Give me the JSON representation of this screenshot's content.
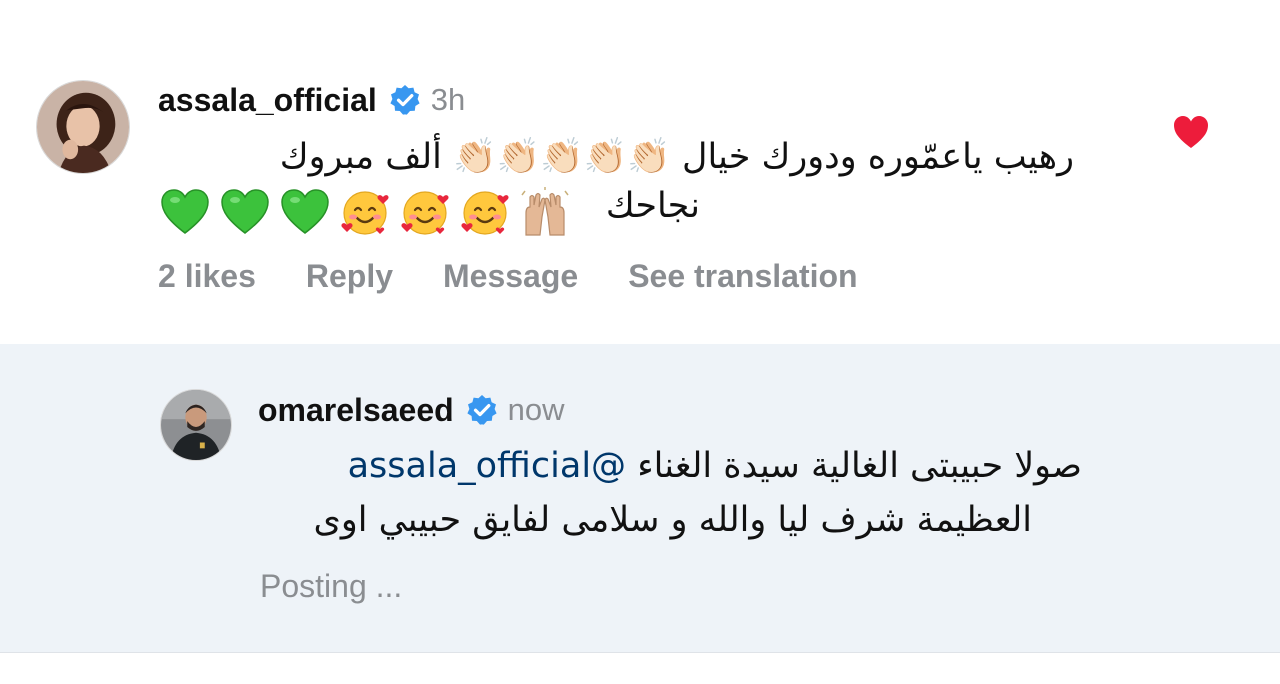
{
  "comment": {
    "username": "assala_official",
    "time": "3h",
    "text_line1": "رهيب ياعمّوره ودورك خيال 👏🏻👏🏻👏🏻👏🏻👏🏻 ألف مبروك",
    "text_line2": "نجاحك",
    "emojis": [
      "raised-hands",
      "smiling-face-with-hearts",
      "smiling-face-with-hearts",
      "smiling-face-with-hearts",
      "green-heart",
      "green-heart",
      "green-heart"
    ],
    "likes": "2 likes",
    "reply_label": "Reply",
    "message_label": "Message",
    "translation_label": "See translation",
    "liked": true,
    "heart_color": "#ed1c3b"
  },
  "reply": {
    "username": "omarelsaeed",
    "time": "now",
    "mention": "@assala_official",
    "text_line1_rest": "صولا حبيبتى الغالية سيدة الغناء",
    "text_line2": "العظيمة شرف ليا والله و سلامى لفايق حبيبي اوى",
    "status": "Posting ..."
  },
  "colors": {
    "verified_badge": "#3897f0",
    "secondary_text": "#8a8d91",
    "mention": "#00376b",
    "reply_background": "#eef3f8"
  }
}
